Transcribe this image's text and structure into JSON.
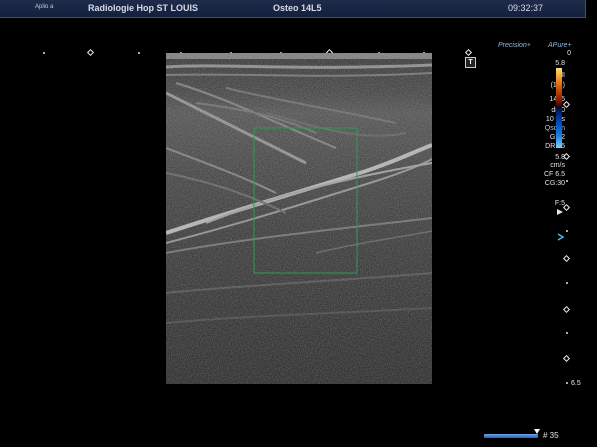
{
  "header": {
    "app": "Aplio a",
    "institution": "Radiologie Hop ST LOUIS",
    "study": "Osteo 14L5",
    "time": "09:32:37"
  },
  "modes": {
    "precision": "Precision+",
    "apure": "APure+",
    "t_marker": "T"
  },
  "params": {
    "scale_top": "5.8",
    "mi_label": "MI",
    "mi_value": "(1.1)",
    "probe": "14L5",
    "depth": "d8.0",
    "fps": "10 fps",
    "qscan": "Qscan",
    "gain": "G:82",
    "dr": "DR:75",
    "velocity": "5.8",
    "velocity_unit": "cm/s",
    "cf": "CF 6.5",
    "cg": "CG:30",
    "focus": "F:5",
    "depth_scale_end": "6.5",
    "zero": "0"
  },
  "footer": {
    "frame": "# 35",
    "cine_progress": 0.95
  },
  "colors": {
    "header_bg": "#1a2645",
    "color_box": "#2e9a5a",
    "focus_marker": "#4fb3e6"
  }
}
